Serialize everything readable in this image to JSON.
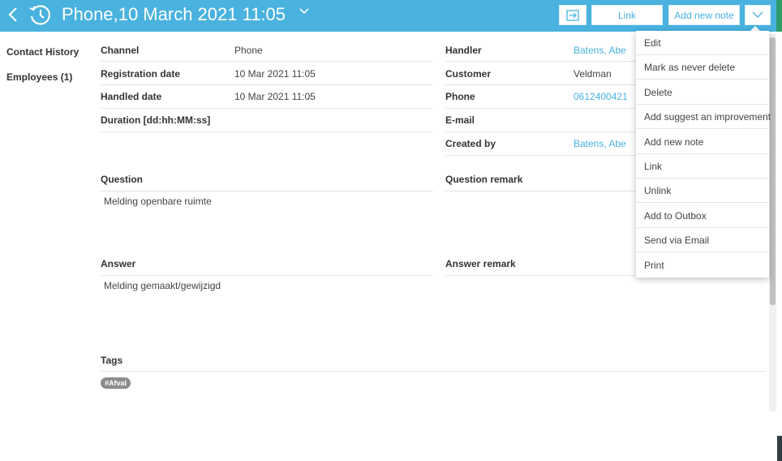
{
  "header": {
    "title": "Phone,10 March 2021 11:05",
    "link_label": "Link",
    "add_note_label": "Add new note"
  },
  "sidebar": {
    "items": [
      {
        "label": "Contact History"
      },
      {
        "label": "Employees (1)"
      }
    ]
  },
  "details_left": [
    {
      "label": "Channel",
      "value": "Phone"
    },
    {
      "label": "Registration date",
      "value": "10 Mar 2021 11:05"
    },
    {
      "label": "Handled date",
      "value": "10 Mar 2021 11:05"
    },
    {
      "label": "Duration [dd:hh:MM:ss]",
      "value": ""
    }
  ],
  "details_right": [
    {
      "label": "Handler",
      "value": "Batens, Abe"
    },
    {
      "label": "Customer",
      "value": "Veldman"
    },
    {
      "label": "Phone",
      "value": "0612400421"
    },
    {
      "label": "E-mail",
      "value": ""
    },
    {
      "label": "Created by",
      "value": "Batens, Abe"
    }
  ],
  "sections": {
    "question_label": "Question",
    "question_text": "Melding openbare ruimte",
    "question_remark_label": "Question remark",
    "answer_label": "Answer",
    "answer_text": "Melding gemaakt/gewijzigd",
    "answer_remark_label": "Answer remark",
    "tags_label": "Tags",
    "tags": [
      "#Afval"
    ]
  },
  "menu": {
    "items": [
      {
        "label": "Edit"
      },
      {
        "label": "Mark as never delete"
      },
      {
        "label": "Delete"
      },
      {
        "label": "Add suggest an improvement"
      },
      {
        "label": "Add new note"
      },
      {
        "label": "Link"
      },
      {
        "label": "Unlink"
      },
      {
        "label": "Add to Outbox"
      },
      {
        "label": "Send via Email"
      },
      {
        "label": "Print"
      }
    ]
  },
  "colors": {
    "header": "#49b2df",
    "link": "#49b2df",
    "tag": "#8c8c8c"
  }
}
